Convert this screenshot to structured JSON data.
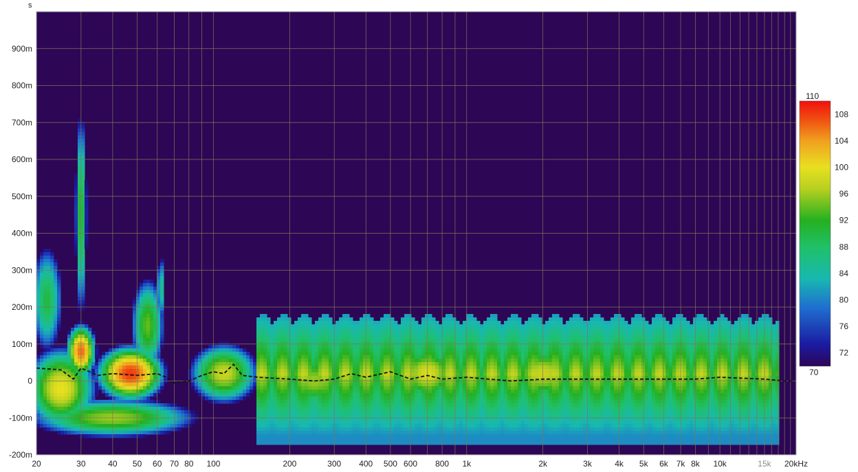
{
  "chart_data": {
    "type": "heatmap",
    "title": "",
    "x_scale": "log",
    "xlim": [
      20,
      20000
    ],
    "ylim": [
      -0.2,
      1.0
    ],
    "y_unit": "s",
    "x_tick_labels": [
      {
        "v": 20,
        "t": "20"
      },
      {
        "v": 30,
        "t": "30"
      },
      {
        "v": 40,
        "t": "40"
      },
      {
        "v": 50,
        "t": "50"
      },
      {
        "v": 60,
        "t": "60"
      },
      {
        "v": 70,
        "t": "70"
      },
      {
        "v": 80,
        "t": "80"
      },
      {
        "v": 100,
        "t": "100"
      },
      {
        "v": 200,
        "t": "200"
      },
      {
        "v": 300,
        "t": "300"
      },
      {
        "v": 400,
        "t": "400"
      },
      {
        "v": 500,
        "t": "500"
      },
      {
        "v": 600,
        "t": "600"
      },
      {
        "v": 800,
        "t": "800"
      },
      {
        "v": 1000,
        "t": "1k"
      },
      {
        "v": 2000,
        "t": "2k"
      },
      {
        "v": 3000,
        "t": "3k"
      },
      {
        "v": 4000,
        "t": "4k"
      },
      {
        "v": 5000,
        "t": "5k"
      },
      {
        "v": 6000,
        "t": "6k"
      },
      {
        "v": 7000,
        "t": "7k"
      },
      {
        "v": 8000,
        "t": "8k"
      },
      {
        "v": 10000,
        "t": "10k"
      },
      {
        "v": 15000,
        "t": "15k",
        "dim": true
      },
      {
        "v": 20000,
        "t": "20kHz"
      }
    ],
    "y_tick_labels": [
      {
        "v": 0.9,
        "t": "900m"
      },
      {
        "v": 0.8,
        "t": "800m"
      },
      {
        "v": 0.7,
        "t": "700m"
      },
      {
        "v": 0.6,
        "t": "600m"
      },
      {
        "v": 0.5,
        "t": "500m"
      },
      {
        "v": 0.4,
        "t": "400m"
      },
      {
        "v": 0.3,
        "t": "300m"
      },
      {
        "v": 0.2,
        "t": "200m"
      },
      {
        "v": 0.1,
        "t": "100m"
      },
      {
        "v": 0.0,
        "t": "0"
      },
      {
        "v": -0.1,
        "t": "-100m"
      },
      {
        "v": -0.2,
        "t": "-200m"
      }
    ],
    "colorbar": {
      "range": [
        70,
        110
      ],
      "top_label": "110",
      "bottom_label": "70",
      "ticks": [
        {
          "v": 108,
          "t": "108"
        },
        {
          "v": 104,
          "t": "104"
        },
        {
          "v": 100,
          "t": "100"
        },
        {
          "v": 96,
          "t": "96"
        },
        {
          "v": 92,
          "t": "92"
        },
        {
          "v": 88,
          "t": "88"
        },
        {
          "v": 84,
          "t": "84"
        },
        {
          "v": 80,
          "t": "80"
        },
        {
          "v": 76,
          "t": "76"
        },
        {
          "v": 72,
          "t": "72"
        }
      ]
    },
    "colors": {
      "background": "#2e0656",
      "grid": "#7a7a55",
      "peak_line": "#111111"
    },
    "blobs": [
      {
        "f": 30,
        "t": 0.08,
        "sf": 0.04,
        "st": 0.05,
        "db": 106
      },
      {
        "f": 47,
        "t": 0.02,
        "sf": 0.09,
        "st": 0.05,
        "db": 108
      },
      {
        "f": 25,
        "t": -0.02,
        "sf": 0.1,
        "st": 0.08,
        "db": 100
      },
      {
        "f": 30,
        "t": 0.45,
        "sf": 0.018,
        "st": 0.22,
        "db": 92
      },
      {
        "f": 22,
        "t": 0.22,
        "sf": 0.05,
        "st": 0.12,
        "db": 90
      },
      {
        "f": 55,
        "t": 0.15,
        "sf": 0.05,
        "st": 0.1,
        "db": 94
      },
      {
        "f": 62,
        "t": 0.25,
        "sf": 0.015,
        "st": 0.08,
        "db": 86
      },
      {
        "f": 40,
        "t": -0.1,
        "sf": 0.25,
        "st": 0.04,
        "db": 96
      },
      {
        "f": 110,
        "t": 0.02,
        "sf": 0.1,
        "st": 0.06,
        "db": 98
      },
      {
        "f": 250,
        "t": 0.0,
        "sf": 0.12,
        "st": 0.06,
        "db": 96
      },
      {
        "f": 700,
        "t": 0.02,
        "sf": 0.1,
        "st": 0.06,
        "db": 99
      },
      {
        "f": 2000,
        "t": 0.02,
        "sf": 0.12,
        "st": 0.06,
        "db": 98
      },
      {
        "f": 6000,
        "t": 0.02,
        "sf": 0.2,
        "st": 0.06,
        "db": 92
      }
    ],
    "peak_time_line": {
      "x": [
        20,
        25,
        28,
        30,
        35,
        40,
        50,
        60,
        65,
        70,
        80,
        90,
        100,
        110,
        120,
        130,
        150,
        200,
        250,
        300,
        350,
        400,
        500,
        600,
        700,
        800,
        1000,
        1500,
        2000,
        3000,
        5000,
        8000,
        10000,
        15000,
        18000,
        19500
      ],
      "y": [
        0.035,
        0.03,
        0.005,
        0.035,
        0.015,
        0.02,
        0.015,
        0.02,
        0.01,
        -0.005,
        0.0,
        0.015,
        0.025,
        0.02,
        0.045,
        0.015,
        0.01,
        0.005,
        0.0,
        0.005,
        0.02,
        0.01,
        0.025,
        0.005,
        0.015,
        0.005,
        0.01,
        0.0,
        0.005,
        0.005,
        0.005,
        0.005,
        0.01,
        0.005,
        0.0,
        0.0
      ]
    },
    "right_edge_line": {
      "x": 19500,
      "y": [
        0.0,
        0.98
      ]
    }
  }
}
